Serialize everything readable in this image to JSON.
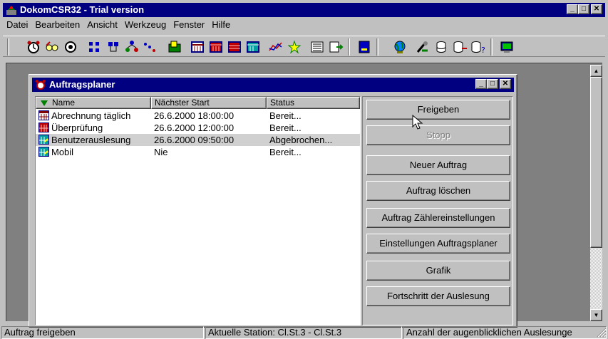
{
  "app": {
    "title": "DokomCSR32 - Trial version"
  },
  "menu": [
    {
      "label": "Datei"
    },
    {
      "label": "Bearbeiten"
    },
    {
      "label": "Ansicht"
    },
    {
      "label": "Werkzeug"
    },
    {
      "label": "Fenster"
    },
    {
      "label": "Hilfe"
    }
  ],
  "toolbar_icons": [
    "alarm-clock-icon",
    "glasses-icon",
    "eye-icon",
    "network-icon",
    "stations-icon",
    "tree-icon",
    "graph-icon",
    "export-icon",
    "calendar-icon",
    "calendar-red-icon",
    "calendar-red-2-icon",
    "calendar-green-icon",
    "chart-line-icon",
    "chart-star-icon",
    "list-icon",
    "list-arrow-icon",
    "blue-square-icon",
    "globe-icon",
    "tools-icon",
    "database-icon",
    "database-export-icon",
    "database-query-icon",
    "screen-icon"
  ],
  "child": {
    "title": "Auftragsplaner",
    "columns": [
      "Name",
      "Nächster Start",
      "Status"
    ],
    "rows": [
      {
        "name": "Abrechnung täglich",
        "start": "26.6.2000 18:00:00",
        "status": "Bereit...",
        "icon": "calendar-icon"
      },
      {
        "name": "Überprüfung",
        "start": "26.6.2000 12:00:00",
        "status": "Bereit...",
        "icon": "calendar-icon"
      },
      {
        "name": "Benutzerauslesung",
        "start": "26.6.2000 09:50:00",
        "status": "Abgebrochen...",
        "icon": "calendar-green-icon",
        "selected": true
      },
      {
        "name": "Mobil",
        "start": "Nie",
        "status": "Bereit...",
        "icon": "calendar-green-icon"
      }
    ],
    "buttons": {
      "freigeben": "Freigeben",
      "stopp": "Stopp",
      "neuer_auftrag": "Neuer Auftrag",
      "auftrag_loeschen": "Auftrag löschen",
      "zaehlereinstellungen": "Auftrag Zählereinstellungen",
      "einstellungen": "Einstellungen Auftragsplaner",
      "grafik": "Grafik",
      "fortschritt": "Fortschritt der Auslesung"
    }
  },
  "status": {
    "left": "Auftrag freigeben",
    "middle": "Aktuelle Station: Cl.St.3 - Cl.St.3",
    "right": "Anzahl der augenblicklichen Auslesunge"
  }
}
